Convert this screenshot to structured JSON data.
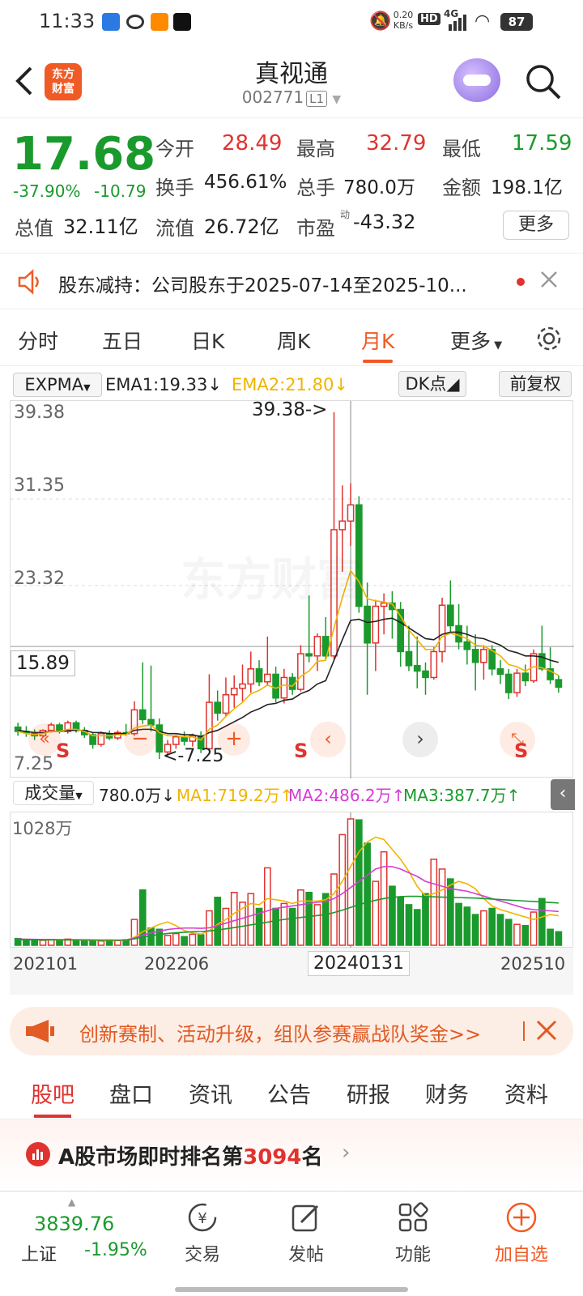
{
  "status_bar": {
    "time": "11:33",
    "net_speed": "0.20\nKB/s",
    "net_badge": "HD",
    "signal": "4G",
    "battery": "87"
  },
  "header": {
    "logo_text": "东方\n财富",
    "title": "真视通",
    "code": "002771",
    "level": "L1"
  },
  "quote": {
    "price": "17.68",
    "change_pct": "-37.90%",
    "change": "-10.79",
    "open_label": "今开",
    "open": "28.49",
    "high_label": "最高",
    "high": "32.79",
    "low_label": "最低",
    "low": "17.59",
    "turnover_label": "换手",
    "turnover": "456.61%",
    "volume_label": "总手",
    "volume": "780.0万",
    "amount_label": "金额",
    "amount": "198.1亿",
    "total_cap_label": "总值",
    "total_cap": "32.11亿",
    "float_cap_label": "流值",
    "float_cap": "26.72亿",
    "pe_label": "市盈",
    "pe_sup": "动",
    "pe": "-43.32",
    "more": "更多"
  },
  "notice": {
    "text": "股东减持：公司股东于2025-07-14至2025-10..."
  },
  "kline_tabs": [
    "分时",
    "五日",
    "日K",
    "周K",
    "月K",
    "更多"
  ],
  "active_tab": "月K",
  "indicator": {
    "name": "EXPMA",
    "ema1": "EMA1:19.33",
    "ema2": "EMA2:21.80",
    "dk": "DK点",
    "adjust": "前复权"
  },
  "chart_labels": {
    "y_max": "39.38",
    "y_2": "31.35",
    "y_3": "23.32",
    "y_cur": "15.89",
    "y_min": "7.25",
    "max_note": "39.38->",
    "min_note": "<-7.25"
  },
  "volume": {
    "name": "成交量",
    "value": "780.0万",
    "ma1": "MA1:719.2万",
    "ma2": "MA2:486.2万",
    "ma3": "MA3:387.7万",
    "y_max": "1028万"
  },
  "x_axis": [
    "202101",
    "202206",
    "20240131",
    "202510"
  ],
  "colors": {
    "up": "#e0332f",
    "down": "#1a9a2c",
    "ema1": "#222222",
    "ema2": "#f0b400",
    "ma1": "#f0b400",
    "ma2": "#d63cd6",
    "ma3": "#1a9a2c",
    "accent": "#f05a24"
  },
  "promo": {
    "text": "创新赛制、活动升级，组队参赛赢战队奖金>>"
  },
  "bottom_tabs": [
    "股吧",
    "盘口",
    "资讯",
    "公告",
    "研报",
    "财务",
    "资料"
  ],
  "active_bottom_tab": "股吧",
  "rank": {
    "prefix": "A股市场即时排名第",
    "number": "3094",
    "suffix": "名"
  },
  "index": {
    "value": "3839.76",
    "name": "上证",
    "change": "-1.95%"
  },
  "nav": [
    {
      "label": "交易",
      "icon": "yen-icon"
    },
    {
      "label": "发帖",
      "icon": "edit-icon"
    },
    {
      "label": "功能",
      "icon": "grid-icon"
    },
    {
      "label": "加自选",
      "icon": "add-icon"
    }
  ],
  "chart_data": {
    "type": "candlestick",
    "y_range": [
      7.25,
      39.38
    ],
    "volume_max": 1028,
    "candles": [
      [
        10.2,
        10.6,
        9.4,
        9.8
      ],
      [
        9.8,
        10.3,
        9.3,
        9.7
      ],
      [
        9.7,
        10.0,
        9.0,
        9.4
      ],
      [
        9.4,
        10.0,
        9.3,
        9.9
      ],
      [
        9.9,
        10.6,
        9.7,
        10.4
      ],
      [
        10.4,
        10.6,
        9.6,
        9.8
      ],
      [
        9.8,
        10.8,
        9.6,
        10.6
      ],
      [
        10.6,
        10.8,
        9.7,
        9.9
      ],
      [
        9.9,
        10.2,
        9.2,
        9.5
      ],
      [
        9.5,
        9.7,
        8.2,
        8.6
      ],
      [
        8.6,
        9.8,
        8.4,
        9.6
      ],
      [
        9.6,
        9.9,
        9.0,
        9.2
      ],
      [
        9.2,
        9.9,
        9.0,
        9.7
      ],
      [
        9.7,
        10.5,
        9.4,
        9.6
      ],
      [
        9.6,
        12.6,
        9.4,
        11.8
      ],
      [
        11.8,
        16.2,
        10.5,
        10.9
      ],
      [
        10.9,
        15.9,
        9.8,
        10.4
      ],
      [
        10.4,
        11.0,
        7.25,
        7.9
      ],
      [
        7.9,
        9.0,
        7.5,
        8.6
      ],
      [
        8.6,
        9.5,
        8.2,
        9.3
      ],
      [
        9.3,
        9.8,
        8.5,
        8.9
      ],
      [
        8.9,
        9.6,
        8.4,
        9.4
      ],
      [
        9.4,
        9.8,
        7.8,
        8.2
      ],
      [
        8.2,
        15.1,
        8.0,
        12.5
      ],
      [
        12.5,
        13.6,
        10.8,
        11.5
      ],
      [
        11.5,
        14.8,
        11.2,
        13.2
      ],
      [
        13.2,
        15.0,
        12.0,
        13.8
      ],
      [
        13.8,
        16.0,
        12.6,
        14.2
      ],
      [
        14.2,
        17.2,
        13.4,
        15.6
      ],
      [
        15.6,
        16.4,
        14.0,
        14.4
      ],
      [
        14.4,
        18.6,
        14.0,
        15.1
      ],
      [
        15.1,
        15.8,
        12.5,
        12.9
      ],
      [
        12.9,
        15.6,
        12.4,
        14.8
      ],
      [
        14.8,
        15.2,
        13.2,
        13.7
      ],
      [
        13.7,
        17.8,
        13.5,
        17.0
      ],
      [
        17.0,
        22.4,
        16.2,
        16.8
      ],
      [
        16.8,
        18.9,
        15.4,
        18.6
      ],
      [
        18.6,
        20.4,
        16.4,
        16.8
      ],
      [
        16.8,
        39.38,
        16.5,
        28.5
      ],
      [
        28.5,
        32.6,
        24.6,
        29.3
      ],
      [
        29.3,
        32.8,
        27.0,
        30.8
      ],
      [
        30.8,
        31.6,
        20.8,
        21.4
      ],
      [
        21.4,
        23.6,
        13.2,
        18.0
      ],
      [
        18.0,
        22.0,
        15.4,
        21.4
      ],
      [
        21.4,
        22.6,
        18.8,
        21.7
      ],
      [
        21.7,
        22.8,
        18.4,
        21.1
      ],
      [
        21.1,
        21.8,
        15.8,
        17.2
      ],
      [
        17.2,
        19.6,
        15.4,
        15.9
      ],
      [
        15.9,
        18.6,
        13.8,
        15.4
      ],
      [
        15.4,
        16.2,
        13.2,
        14.8
      ],
      [
        14.8,
        17.6,
        14.6,
        17.2
      ],
      [
        17.2,
        22.2,
        16.2,
        21.5
      ],
      [
        21.5,
        23.8,
        19.0,
        19.6
      ],
      [
        19.6,
        21.6,
        17.4,
        18.1
      ],
      [
        18.1,
        19.6,
        16.0,
        17.4
      ],
      [
        17.4,
        18.8,
        13.6,
        16.2
      ],
      [
        16.2,
        17.8,
        14.6,
        17.4
      ],
      [
        17.4,
        17.8,
        15.0,
        15.6
      ],
      [
        15.6,
        16.4,
        14.2,
        15.1
      ],
      [
        15.1,
        15.6,
        12.8,
        13.4
      ],
      [
        13.4,
        15.6,
        13.0,
        15.2
      ],
      [
        15.2,
        16.0,
        14.0,
        14.5
      ],
      [
        14.5,
        17.4,
        14.3,
        17.0
      ],
      [
        17.0,
        19.6,
        15.4,
        15.6
      ],
      [
        15.6,
        17.6,
        14.2,
        14.6
      ],
      [
        14.6,
        15.0,
        13.4,
        13.9
      ]
    ],
    "ema1": [
      9.9,
      9.8,
      9.7,
      9.7,
      9.8,
      9.8,
      9.9,
      9.9,
      9.9,
      9.7,
      9.7,
      9.6,
      9.6,
      9.6,
      9.9,
      10.0,
      10.0,
      9.8,
      9.6,
      9.6,
      9.5,
      9.5,
      9.3,
      9.7,
      9.9,
      10.3,
      10.7,
      11.1,
      11.6,
      11.9,
      12.3,
      12.4,
      12.7,
      12.8,
      13.3,
      13.6,
      14.2,
      14.5,
      16.4,
      18.3,
      20.1,
      20.2,
      19.9,
      20.0,
      20.2,
      20.3,
      19.9,
      19.4,
      18.9,
      18.4,
      18.3,
      18.8,
      19.0,
      19.0,
      18.8,
      18.5,
      18.4,
      18.1,
      17.8,
      17.3,
      17.1,
      16.8,
      16.8,
      16.7,
      16.4,
      16.2
    ],
    "ema2": [
      9.8,
      9.6,
      9.5,
      9.6,
      9.8,
      9.8,
      10.0,
      10.0,
      9.8,
      9.4,
      9.4,
      9.4,
      9.5,
      9.5,
      10.1,
      10.3,
      10.4,
      9.7,
      9.4,
      9.4,
      9.3,
      9.3,
      9.0,
      10.0,
      10.4,
      11.2,
      11.9,
      12.5,
      13.3,
      13.6,
      14.1,
      13.8,
      14.1,
      14.0,
      14.9,
      15.4,
      16.3,
      16.4,
      19.4,
      22.2,
      24.7,
      23.7,
      22.1,
      21.9,
      21.8,
      21.6,
      20.5,
      19.2,
      18.3,
      17.4,
      17.4,
      18.6,
      18.9,
      18.7,
      18.4,
      17.8,
      17.7,
      17.3,
      16.8,
      16.0,
      15.8,
      15.4,
      15.8,
      15.7,
      15.4,
      15.0
    ],
    "volumes": [
      55,
      48,
      42,
      40,
      45,
      38,
      50,
      44,
      36,
      40,
      35,
      42,
      38,
      45,
      210,
      450,
      140,
      130,
      80,
      95,
      70,
      90,
      85,
      280,
      390,
      300,
      430,
      350,
      420,
      300,
      630,
      300,
      340,
      300,
      450,
      430,
      330,
      420,
      580,
      900,
      1028,
      1020,
      830,
      520,
      760,
      480,
      390,
      330,
      290,
      420,
      700,
      620,
      540,
      340,
      310,
      250,
      280,
      300,
      250,
      210,
      170,
      160,
      270,
      380,
      130,
      110
    ],
    "ma1": [
      50,
      48,
      46,
      44,
      45,
      43,
      44,
      43,
      41,
      41,
      40,
      40,
      39,
      41,
      66,
      110,
      140,
      170,
      190,
      160,
      120,
      100,
      90,
      120,
      170,
      210,
      260,
      300,
      340,
      330,
      380,
      370,
      360,
      340,
      360,
      360,
      360,
      370,
      420,
      520,
      640,
      760,
      840,
      880,
      860,
      780,
      700,
      600,
      480,
      400,
      420,
      450,
      490,
      520,
      500,
      460,
      380,
      320,
      290,
      270,
      250,
      230,
      210,
      230,
      250,
      240
    ],
    "ma2": [
      50,
      49,
      48,
      47,
      47,
      46,
      46,
      45,
      44,
      43,
      42,
      42,
      41,
      42,
      58,
      82,
      100,
      115,
      128,
      136,
      140,
      140,
      138,
      142,
      160,
      180,
      200,
      220,
      240,
      260,
      280,
      300,
      310,
      320,
      330,
      340,
      350,
      355,
      380,
      420,
      470,
      520,
      570,
      620,
      640,
      640,
      620,
      590,
      560,
      520,
      500,
      480,
      460,
      450,
      440,
      420,
      400,
      380,
      360,
      340,
      320,
      300,
      290,
      285,
      280,
      275
    ],
    "ma3": [
      45,
      45,
      44,
      44,
      44,
      44,
      43,
      43,
      43,
      42,
      42,
      42,
      42,
      43,
      52,
      66,
      78,
      88,
      96,
      102,
      106,
      110,
      112,
      116,
      124,
      134,
      144,
      155,
      166,
      176,
      188,
      200,
      210,
      218,
      226,
      234,
      242,
      250,
      266,
      286,
      308,
      330,
      350,
      366,
      380,
      390,
      396,
      398,
      398,
      396,
      394,
      392,
      390,
      388,
      386,
      384,
      380,
      376,
      372,
      368,
      364,
      360,
      356,
      352,
      348,
      344
    ]
  }
}
